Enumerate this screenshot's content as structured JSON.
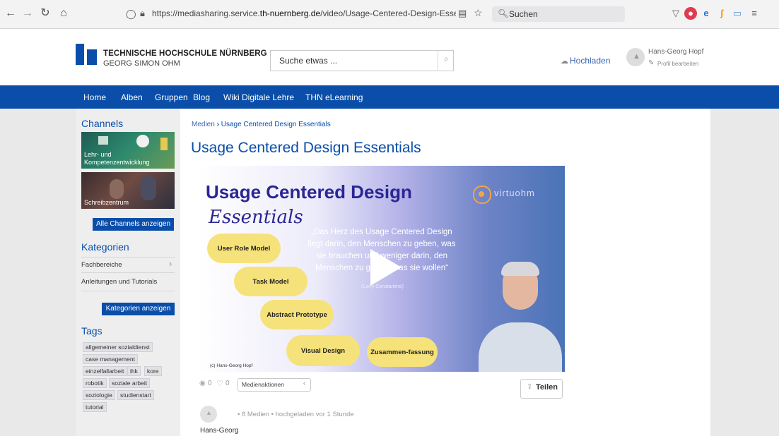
{
  "browser": {
    "url_prefix": "https://mediasharing.service.",
    "url_domain": "th-nuernberg.de",
    "url_suffix": "/video/Usage-Centered-Design-Essentials/0",
    "search_placeholder": "Suchen"
  },
  "header": {
    "logo_line1": "TECHNISCHE HOCHSCHULE NÜRNBERG",
    "logo_line2": "GEORG SIMON OHM",
    "search_placeholder": "Suche etwas ...",
    "upload_label": "Hochladen",
    "user_name": "Hans-Georg Hopf",
    "profile_edit": "Profil bearbeiten"
  },
  "nav": [
    "Home",
    "Alben",
    "Gruppen",
    "Blog",
    "Wiki Digitale Lehre",
    "THN eLearning"
  ],
  "sidebar": {
    "channels_title": "Channels",
    "channels": [
      "Lehr- und Kompetenzentwicklung",
      "Schreibzentrum"
    ],
    "all_channels_button": "Alle Channels anzeigen",
    "categories_title": "Kategorien",
    "categories": [
      "Fachbereiche",
      "Anleitungen und Tutorials"
    ],
    "categories_button": "Kategorien anzeigen",
    "tags_title": "Tags",
    "tags": [
      "allgemeiner sozialdienst",
      "case management",
      "einzelfallarbeit",
      "ihk",
      "kore",
      "robotik",
      "soziale arbeit",
      "soziologie",
      "studienstart",
      "tutorial"
    ]
  },
  "main": {
    "breadcrumb_root": "Medien",
    "breadcrumb_current": "Usage Centered Design Essentials",
    "title": "Usage Centered Design Essentials",
    "views": "0",
    "likes": "0",
    "media_actions": "Medienaktionen",
    "share_label": "Teilen",
    "uploader_meta": "• 8 Medien • hochgeladen vor 1 Stunde",
    "uploader_name": "Hans-Georg"
  },
  "video": {
    "heading": "Usage Centered Design",
    "subheading": "Essentials",
    "brand": "virtuohm",
    "quote": "„Das Herz des Usage Centered Design liegt darin, den Menschen zu geben, was sie brauchen und weniger darin, den Menschen zu geben, was sie wollen“",
    "quote_author": "(Larry Constantine)",
    "copyright": "(c) Hans-Georg Hopf",
    "pills": [
      "User Role Model",
      "Task Model",
      "Abstract Prototype",
      "Visual Design",
      "Zusammen-fassung"
    ]
  }
}
